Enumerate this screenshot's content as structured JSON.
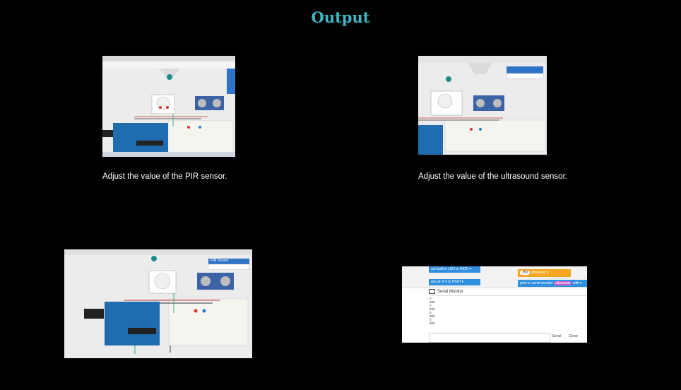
{
  "page": {
    "title": "Output"
  },
  "captions": {
    "pir": "Adjust the value of the PIR sensor.",
    "ultrasound": "Adjust the value of the ultrasound sensor."
  },
  "sim3": {
    "panel_title": "PIR Sensor"
  },
  "code": {
    "block_led": "set built-in LED to",
    "block_led_val": "HIGH ▾",
    "block_pin": "set pin",
    "block_pin_num": "8 ▾",
    "block_pin_to": "to",
    "block_pin_val": "HIGH ▾",
    "block_var_num": "350",
    "block_var_name": "ultrasonic ▾",
    "block_print": "print to serial monitor",
    "block_print_var": "ultrasonic",
    "block_print_with": "with ▾",
    "serial_title": "Serial Monitor",
    "serial_lines": [
      "0",
      "250",
      "0",
      "250",
      "0",
      "250",
      "0",
      "250"
    ],
    "send_label": "Send",
    "clear_label": "Clear"
  },
  "colors": {
    "title": "#3cb8c4",
    "background": "#000000",
    "arduino": "#1f6cb0"
  }
}
